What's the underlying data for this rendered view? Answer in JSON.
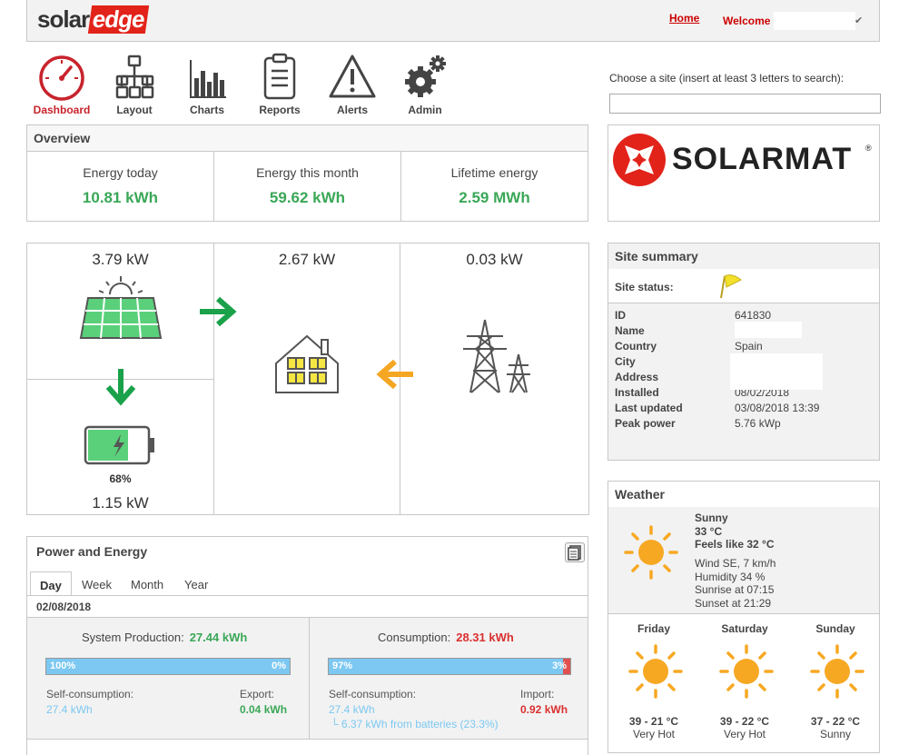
{
  "header": {
    "brand_solar": "solar",
    "brand_edge": "edge",
    "home_link": "Home",
    "welcome": "Welcome ,",
    "welcome_check": "✔"
  },
  "nav": {
    "items": [
      {
        "label": "Dashboard",
        "icon": "speedometer-icon"
      },
      {
        "label": "Layout",
        "icon": "layout-tree-icon"
      },
      {
        "label": "Charts",
        "icon": "bar-chart-icon"
      },
      {
        "label": "Reports",
        "icon": "clipboard-icon"
      },
      {
        "label": "Alerts",
        "icon": "warning-triangle-icon"
      },
      {
        "label": "Admin",
        "icon": "gears-icon"
      }
    ]
  },
  "site_search": {
    "label": "Choose a site (insert at least 3 letters to search):",
    "value": "",
    "placeholder": ""
  },
  "overview": {
    "title": "Overview",
    "cols": [
      {
        "label": "Energy today",
        "value": "10.81 kWh"
      },
      {
        "label": "Energy this month",
        "value": "59.62 kWh"
      },
      {
        "label": "Lifetime energy",
        "value": "2.59 MWh"
      }
    ]
  },
  "site_logo": {
    "name": "SOLARMAT",
    "reg": "®"
  },
  "flow": {
    "pv_power": "3.79 kW",
    "load_power": "2.67 kW",
    "grid_power": "0.03 kW",
    "battery_percent": "68%",
    "battery_level": 0.68,
    "battery_power": "1.15 kW"
  },
  "site_summary": {
    "title": "Site summary",
    "status_label": "Site status:",
    "rows": [
      {
        "key": "ID",
        "value": "641830"
      },
      {
        "key": "Name",
        "value": ""
      },
      {
        "key": "Country",
        "value": "Spain"
      },
      {
        "key": "City",
        "value": ""
      },
      {
        "key": "Address",
        "value": ""
      },
      {
        "key": "Installed",
        "value": "08/02/2018"
      },
      {
        "key": "Last updated",
        "value": "03/08/2018 13:39"
      },
      {
        "key": "Peak power",
        "value": "5.76 kWp"
      }
    ]
  },
  "power_energy": {
    "title": "Power and Energy",
    "tabs": [
      "Day",
      "Week",
      "Month",
      "Year"
    ],
    "active_tab": "Day",
    "date": "02/08/2018",
    "production": {
      "label": "System Production:",
      "value": "27.44 kWh",
      "self_pct": "100%",
      "self_level": 1.0,
      "export_pct": "0%",
      "self_label": "Self-consumption:",
      "self_value": "27.4 kWh",
      "export_label": "Export:",
      "export_value": "0.04 kWh"
    },
    "consumption": {
      "label": "Consumption:",
      "value": "28.31 kWh",
      "self_pct": "97%",
      "self_level": 0.97,
      "import_pct": "3%",
      "self_label": "Self-consumption:",
      "self_value": "27.4 kWh",
      "battery_note": "└ 6.37 kWh from batteries (23.3%)",
      "import_label": "Import:",
      "import_value": "0.92 kWh"
    }
  },
  "weather": {
    "title": "Weather",
    "current": {
      "condition": "Sunny",
      "temp": "33 °C",
      "feels": "Feels like 32 °C",
      "wind": "Wind SE, 7 km/h",
      "humidity": "Humidity 34 %",
      "sunrise": "Sunrise at 07:15",
      "sunset": "Sunset at 21:29"
    },
    "forecast": [
      {
        "day": "Friday",
        "temp": "39 - 21 °C",
        "desc": "Very Hot"
      },
      {
        "day": "Saturday",
        "temp": "39 - 22 °C",
        "desc": "Very Hot"
      },
      {
        "day": "Sunday",
        "temp": "37 - 22 °C",
        "desc": "Sunny"
      }
    ]
  },
  "colors": {
    "brand_red": "#e2231a",
    "green": "#3aa757",
    "orange": "#f5a623",
    "sun": "#f7a823",
    "bar_blue": "#7cc8f2",
    "red_value": "#d9302f"
  }
}
